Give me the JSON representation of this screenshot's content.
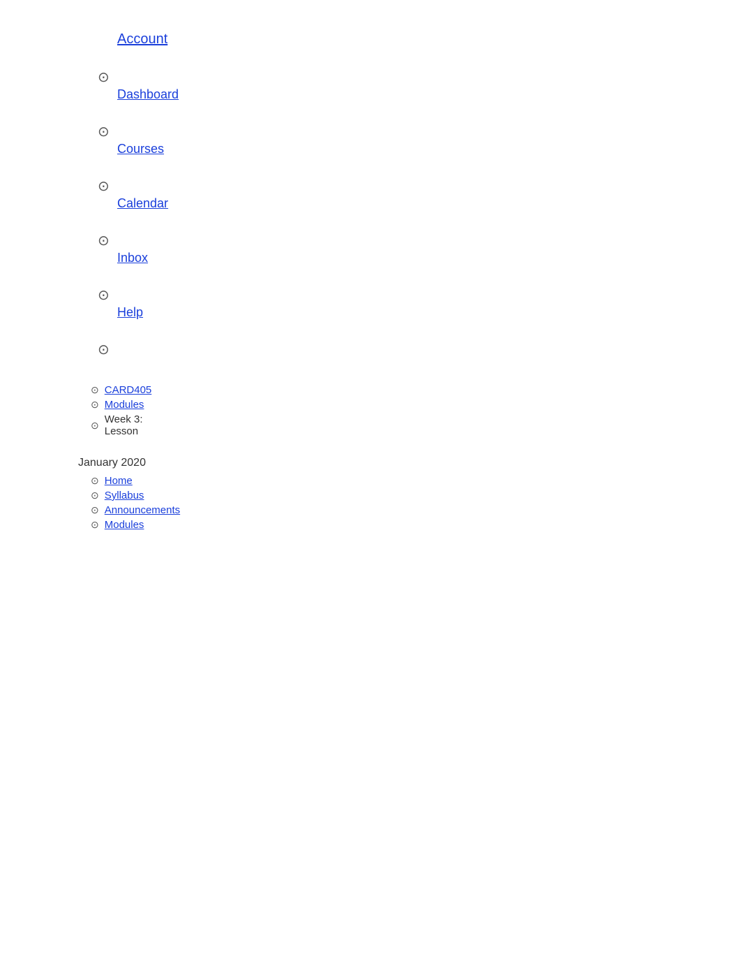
{
  "nav": {
    "account": {
      "label": "Account",
      "icon": "⊙"
    },
    "dashboard": {
      "label": "Dashboard",
      "icon": "⊙"
    },
    "courses": {
      "label": "Courses",
      "icon": "⊙"
    },
    "calendar": {
      "label": "Calendar",
      "icon": "⊙"
    },
    "inbox": {
      "label": "Inbox",
      "icon": "⊙"
    },
    "help": {
      "label": "Help",
      "icon": "⊙"
    },
    "extra_icon": "⊙"
  },
  "breadcrumb": {
    "month": "January 2020",
    "items": [
      {
        "label": "CARD405",
        "type": "link",
        "icon": "⊙"
      },
      {
        "label": "Modules",
        "type": "link",
        "icon": "⊙"
      },
      {
        "label": "Week 3: Lesson",
        "type": "text",
        "icon": "⊙"
      }
    ]
  },
  "course_nav": {
    "items": [
      {
        "label": "Home",
        "icon": "⊙"
      },
      {
        "label": "Syllabus",
        "icon": "⊙"
      },
      {
        "label": "Announcements",
        "icon": "⊙"
      },
      {
        "label": "Modules",
        "icon": "⊙"
      }
    ]
  }
}
